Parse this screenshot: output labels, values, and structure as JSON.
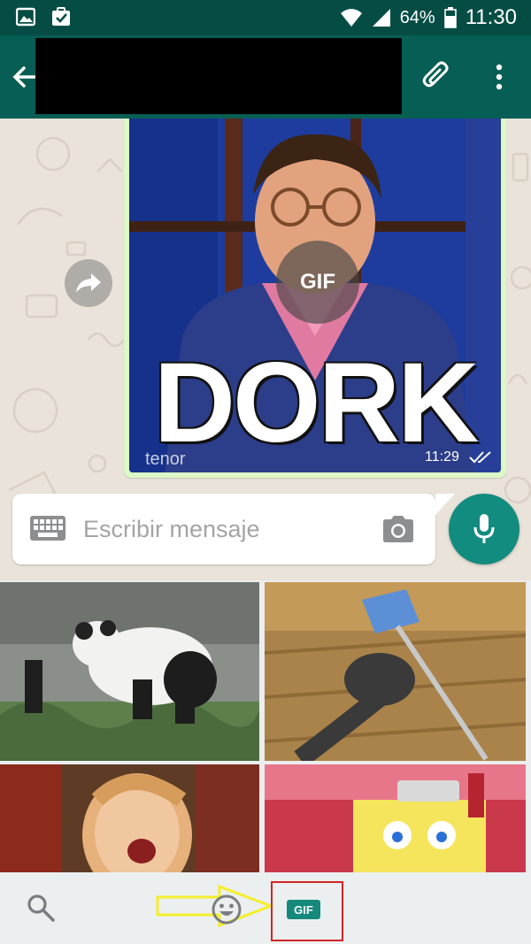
{
  "status_bar": {
    "battery_percent": "64%",
    "time": "11:30"
  },
  "header": {
    "contact_name": ""
  },
  "message": {
    "gif_badge": "GIF",
    "caption": "DORK",
    "watermark": "tenor",
    "time": "11:29",
    "status": "read"
  },
  "composer": {
    "placeholder": "Escribir mensaje"
  },
  "gif_panel": {
    "items": [
      {
        "subject": "panda"
      },
      {
        "subject": "cat-with-mop"
      },
      {
        "subject": "excited-woman"
      },
      {
        "subject": "spongebob"
      }
    ]
  },
  "bottom_bar": {
    "gif_tab_label": "GIF",
    "active_tab": "gif"
  },
  "colors": {
    "header": "#075e54",
    "status_bar": "#054d44",
    "accent": "#128c7e",
    "annotation_box": "#d12525",
    "annotation_arrow": "#f4ef2a"
  }
}
